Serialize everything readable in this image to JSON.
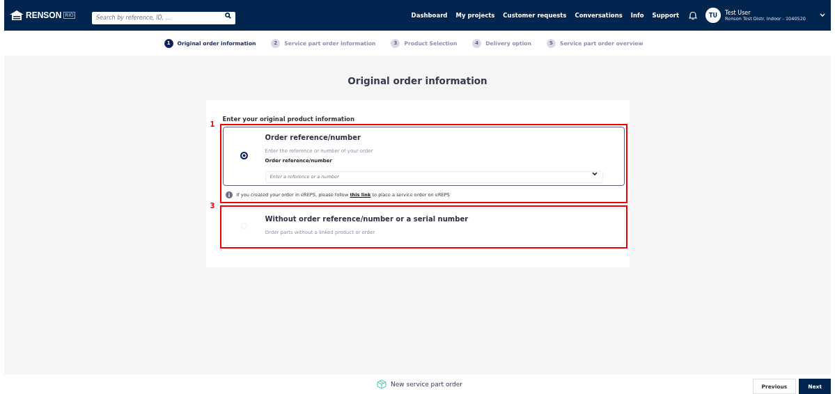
{
  "header": {
    "logo": "RENSON",
    "logo_badge": "RIO",
    "search": {
      "placeholder": "Search by reference, ID, ..."
    },
    "nav": [
      "Dashboard",
      "My projects",
      "Customer requests",
      "Conversations",
      "Info",
      "Support"
    ],
    "user": {
      "initials": "TU",
      "name": "Test User",
      "company": "Renson Test Distr. Indoor - 1040520"
    }
  },
  "steps": [
    {
      "number": "1",
      "label": "Original order information",
      "selected": true
    },
    {
      "number": "2",
      "label": "Service part order Information",
      "selected": false
    },
    {
      "number": "3",
      "label": "Product Selection",
      "selected": false
    },
    {
      "number": "4",
      "label": "Delivery option",
      "selected": false
    },
    {
      "number": "5",
      "label": "Service part order overview",
      "selected": false
    }
  ],
  "page_title": "Original order information",
  "card": {
    "heading": "Enter your original product information",
    "options": [
      {
        "annotation": "1",
        "title": "Order reference/number",
        "description": "Enter the reference or number of your order",
        "field_label": "Order reference/number",
        "placeholder": "Enter a reference or a number",
        "selected": true,
        "note": {
          "before": "If you created your order in eREPS, please follow",
          "link": "this link",
          "after": "to place a service order on eREPS"
        }
      },
      {
        "annotation": "3",
        "title": "Without order reference/number or a serial number",
        "description": "Order parts without a linked product or order",
        "selected": false
      }
    ]
  },
  "footer": {
    "title": "New service part order",
    "buttons": [
      {
        "label": "Previous",
        "kind": "secondary"
      },
      {
        "label": "Next",
        "kind": "primary"
      }
    ]
  }
}
